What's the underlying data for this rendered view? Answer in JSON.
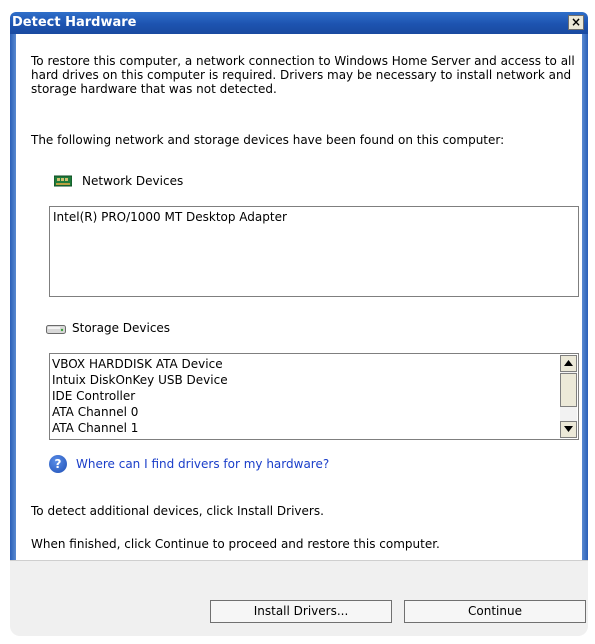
{
  "window": {
    "title": "Detect Hardware",
    "close_glyph": "×"
  },
  "content": {
    "intro": "To restore this computer, a network connection to Windows Home Server and access to all hard drives on this computer is required. Drivers may be necessary to install network and storage hardware that was not detected.",
    "found": "The following network and storage devices have been found on this computer:",
    "detect_hint": "To detect additional devices, click Install Drivers.",
    "finish_hint": "When finished, click Continue to proceed and restore this computer."
  },
  "network": {
    "label": "Network Devices",
    "icon": "network-adapter-icon",
    "items": [
      "Intel(R) PRO/1000 MT Desktop Adapter"
    ]
  },
  "storage": {
    "label": "Storage Devices",
    "icon": "hard-drive-icon",
    "items": [
      "VBOX HARDDISK ATA Device",
      "Intuix DiskOnKey USB Device",
      "IDE Controller",
      "ATA Channel 0",
      "ATA Channel 1"
    ]
  },
  "help": {
    "icon": "help-icon",
    "link_text": "Where can I find drivers for my hardware?"
  },
  "buttons": {
    "install": "Install Drivers...",
    "continue": "Continue"
  },
  "colors": {
    "title_bar": "#1d53b0",
    "link": "#1a3ec9",
    "footer": "#f0f0f0"
  }
}
